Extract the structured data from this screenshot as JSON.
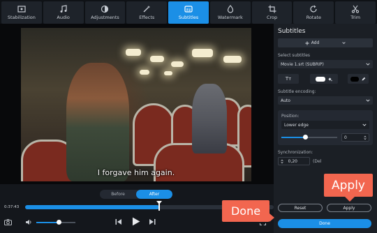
{
  "toolbar": {
    "tools": [
      {
        "label": "Stabilization",
        "icon": "stabilization-icon"
      },
      {
        "label": "Audio",
        "icon": "music-note-icon"
      },
      {
        "label": "Adjustments",
        "icon": "adjustments-icon"
      },
      {
        "label": "Effects",
        "icon": "magic-wand-icon"
      },
      {
        "label": "Subtitles",
        "icon": "subtitles-icon",
        "active": true
      },
      {
        "label": "Watermark",
        "icon": "watermark-icon"
      },
      {
        "label": "Crop",
        "icon": "crop-icon"
      },
      {
        "label": "Rotate",
        "icon": "rotate-icon"
      },
      {
        "label": "Trim",
        "icon": "scissors-icon"
      }
    ]
  },
  "video": {
    "subtitle_line": "I forgave him again."
  },
  "controls": {
    "before_label": "Before",
    "after_label": "After",
    "current_time": "0:37:43",
    "progress": 0.54,
    "volume": 0.57
  },
  "panel": {
    "title": "Subtitles",
    "add_label": "Add",
    "select_subtitles_label": "Select subtitles",
    "selected_subtitle": "Movie 1.srt (SUBRIP)",
    "text_style_glyph": "Tт",
    "encoding_label": "Subtitle encoding:",
    "encoding_value": "Auto",
    "position_label": "Position:",
    "position_value": "Lower edge",
    "position_offset": "0",
    "sync_label": "Synchronization:",
    "sync_value": "0,20",
    "sync_suffix": "(Del",
    "reset_label": "Reset",
    "apply_label": "Apply",
    "done_label": "Done"
  },
  "callouts": {
    "apply": "Apply",
    "done": "Done"
  },
  "colors": {
    "accent": "#1b8fe6",
    "callout": "#f2664f",
    "panel_bg": "#1b1f25",
    "app_bg": "#14171c"
  }
}
